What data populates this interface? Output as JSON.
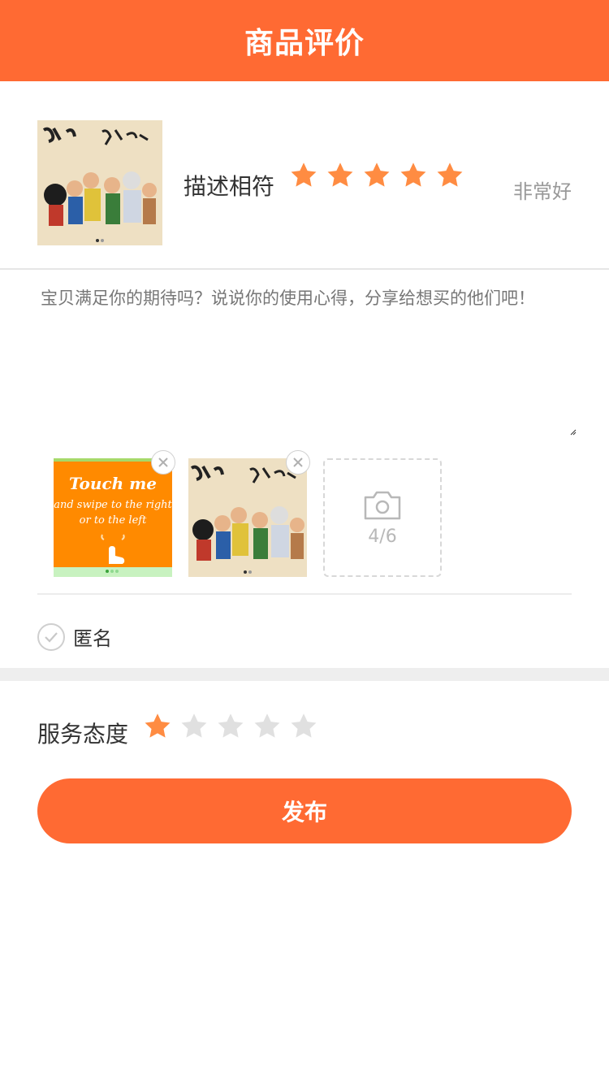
{
  "header": {
    "title": "商品评价"
  },
  "product": {
    "image_name": "product-thumbnail",
    "rating_label": "描述相符",
    "rating": 5,
    "rating_max": 5,
    "rating_text": "非常好"
  },
  "review": {
    "placeholder": "宝贝满足你的期待吗？说说你的使用心得，分享给想买的他们吧！",
    "value": ""
  },
  "images": {
    "uploaded": [
      {
        "name": "uploaded-image-touch",
        "lines": [
          "Touch me",
          "and swipe to the right",
          "or to the left"
        ]
      },
      {
        "name": "uploaded-image-comic"
      }
    ],
    "count_text": "4/6",
    "add_icon": "camera-icon",
    "remove_icon": "close-icon"
  },
  "anonymous": {
    "label": "匿名",
    "checked": false,
    "icon": "check-icon"
  },
  "service": {
    "label": "服务态度",
    "rating": 1,
    "rating_max": 5
  },
  "publish": {
    "label": "发布"
  },
  "colors": {
    "accent": "#ff6a33",
    "star_active": "#ff8c42",
    "star_inactive": "#e0e0e0",
    "muted_text": "#999999"
  }
}
